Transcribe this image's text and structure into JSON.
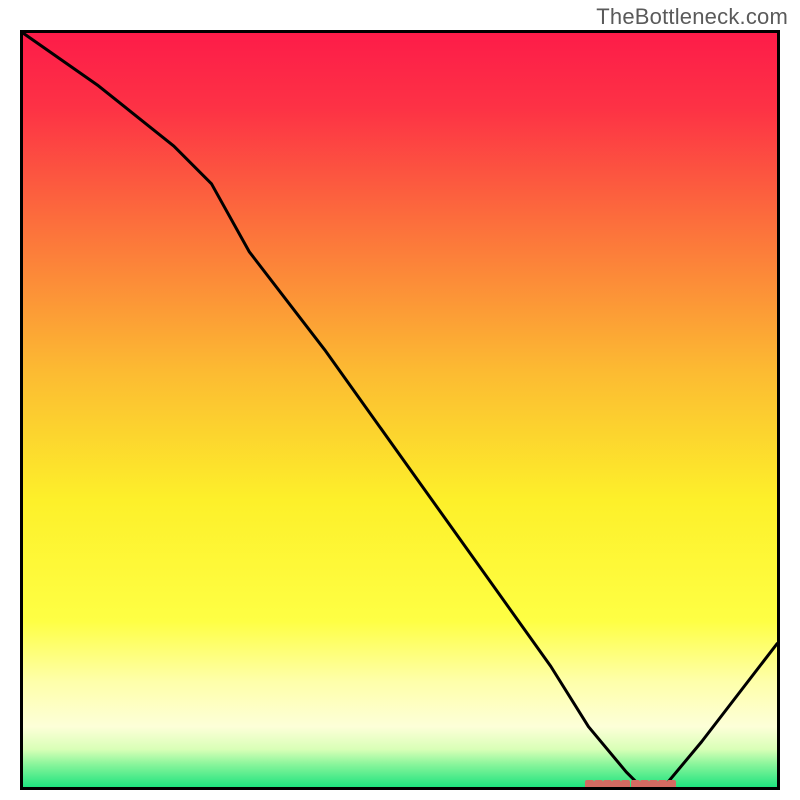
{
  "watermark": "TheBottleneck.com",
  "chart_data": {
    "type": "line",
    "title": "",
    "xlabel": "",
    "ylabel": "",
    "x": [
      0,
      10,
      20,
      25,
      30,
      40,
      50,
      60,
      70,
      75,
      80,
      82,
      85,
      90,
      100
    ],
    "values": [
      100,
      93,
      85,
      80,
      71,
      58,
      44,
      30,
      16,
      8,
      2,
      0,
      0,
      6,
      19
    ],
    "xlim": [
      0,
      100
    ],
    "ylim": [
      0,
      100
    ],
    "curve_note": "V-shaped bottleneck curve with minimum plateau around x≈80–85",
    "marker_plateau": {
      "x_start": 75,
      "x_end": 86,
      "y": 0
    },
    "background_gradient_stops": [
      {
        "pct": 0,
        "color": "#fd1c49"
      },
      {
        "pct": 10,
        "color": "#fd3245"
      },
      {
        "pct": 25,
        "color": "#fc6e3c"
      },
      {
        "pct": 45,
        "color": "#fcbb32"
      },
      {
        "pct": 62,
        "color": "#fdf02a"
      },
      {
        "pct": 78,
        "color": "#feff44"
      },
      {
        "pct": 86,
        "color": "#feffaa"
      },
      {
        "pct": 92,
        "color": "#fdffd8"
      },
      {
        "pct": 95,
        "color": "#d9ffb7"
      },
      {
        "pct": 97,
        "color": "#89f59b"
      },
      {
        "pct": 100,
        "color": "#1fe37f"
      }
    ]
  }
}
